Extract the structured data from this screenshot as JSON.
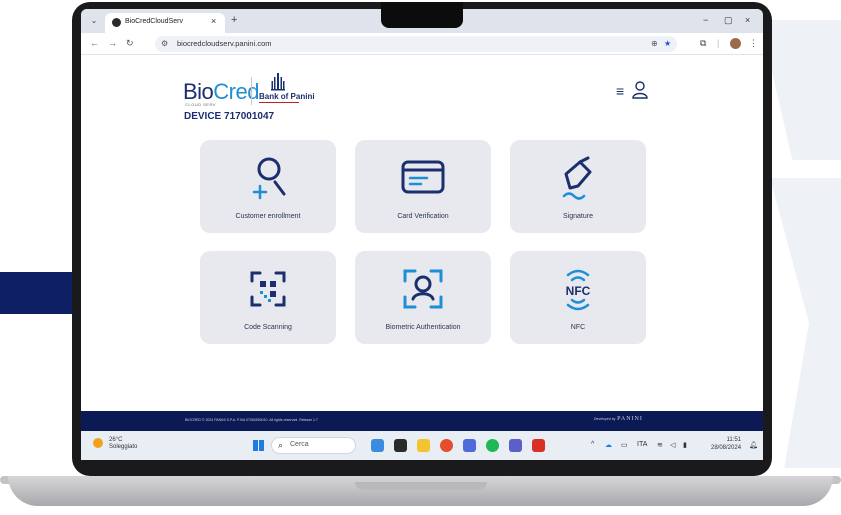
{
  "browser": {
    "tab_title": "BioCredCloudServ",
    "tab_close": "×",
    "new_tab": "+",
    "url": "biocredcloudserv.panini.com",
    "win_min": "−",
    "win_max": "▢",
    "win_close": "×"
  },
  "header": {
    "logo_bio": "Bio",
    "logo_cred": "Cred",
    "logo_sub": "CLOUD SERV",
    "bank_name": "Bank of Panini",
    "device_label": "DEVICE",
    "device_id": "717001047"
  },
  "tiles": [
    {
      "label": "Customer enrollment",
      "icon": "user-add-icon"
    },
    {
      "label": "Card Verification",
      "icon": "card-icon"
    },
    {
      "label": "Signature",
      "icon": "pen-icon"
    },
    {
      "label": "Code Scanning",
      "icon": "qr-scan-icon"
    },
    {
      "label": "Biometric Authentication",
      "icon": "face-scan-icon"
    },
    {
      "label": "NFC",
      "icon": "nfc-icon",
      "text": "NFC"
    }
  ],
  "footer": {
    "left_text": "BIOCRED © 2024 PANINI S.P.A. P.IVA 07060550010. All rights reserved. Release 1.7",
    "right_prefix": "Developed by",
    "right_brand": "PANINI"
  },
  "taskbar": {
    "temp": "26°C",
    "weather": "Soleggiato",
    "search_placeholder": "Cerca",
    "lang": "ITA",
    "time": "11:51",
    "date": "28/08/2024"
  },
  "colors": {
    "brand_navy": "#1b2f6e",
    "brand_blue": "#1e8fd6",
    "footer_bg": "#0b1a55",
    "tile_bg": "#e7e9ee"
  }
}
